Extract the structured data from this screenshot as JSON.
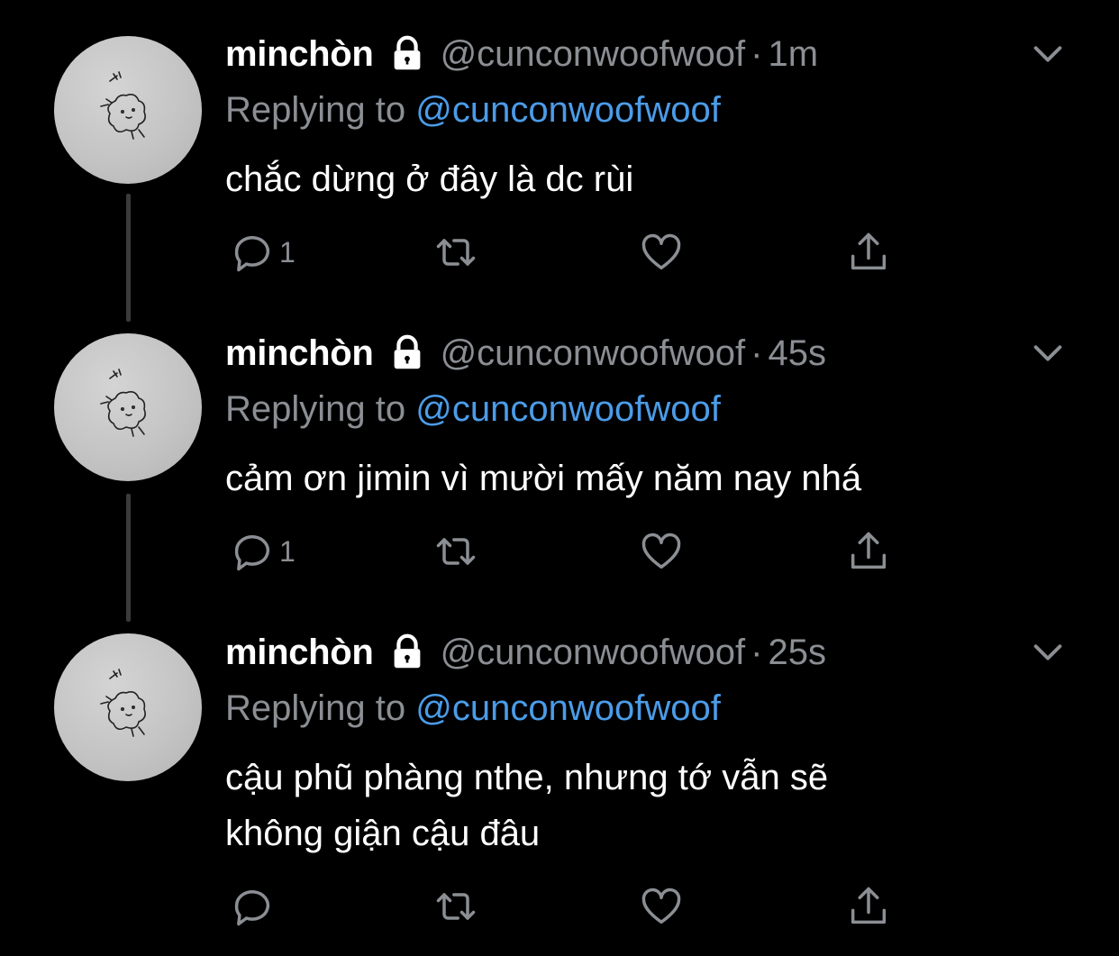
{
  "tweets": [
    {
      "display_name": "minchòn",
      "handle": "@cunconwoofwoof",
      "separator": "·",
      "time": "1m",
      "reply_label": "Replying to",
      "reply_handle": "@cunconwoofwoof",
      "lines": [
        "chắc dừng ở đây là dc rùi"
      ],
      "reply_count": "1"
    },
    {
      "display_name": "minchòn",
      "handle": "@cunconwoofwoof",
      "separator": "·",
      "time": "45s",
      "reply_label": "Replying to",
      "reply_handle": "@cunconwoofwoof",
      "lines": [
        "cảm ơn jimin vì mười mấy năm nay nhá"
      ],
      "reply_count": "1"
    },
    {
      "display_name": "minchòn",
      "handle": "@cunconwoofwoof",
      "separator": "·",
      "time": "25s",
      "reply_label": "Replying to",
      "reply_handle": "@cunconwoofwoof",
      "lines": [
        "cậu phũ phàng nthe, nhưng tớ vẫn sẽ",
        "không giận cậu đâu"
      ],
      "reply_count": ""
    }
  ],
  "icons": {
    "lock": "lock-icon",
    "chevron": "chevron-down-icon",
    "reply": "reply-icon",
    "retweet": "retweet-icon",
    "like": "heart-icon",
    "share": "share-icon"
  },
  "colors": {
    "background": "#000000",
    "text": "#ffffff",
    "secondary": "#8b8f94",
    "link": "#4b9ce8",
    "thread_line": "#3a3a3c"
  }
}
